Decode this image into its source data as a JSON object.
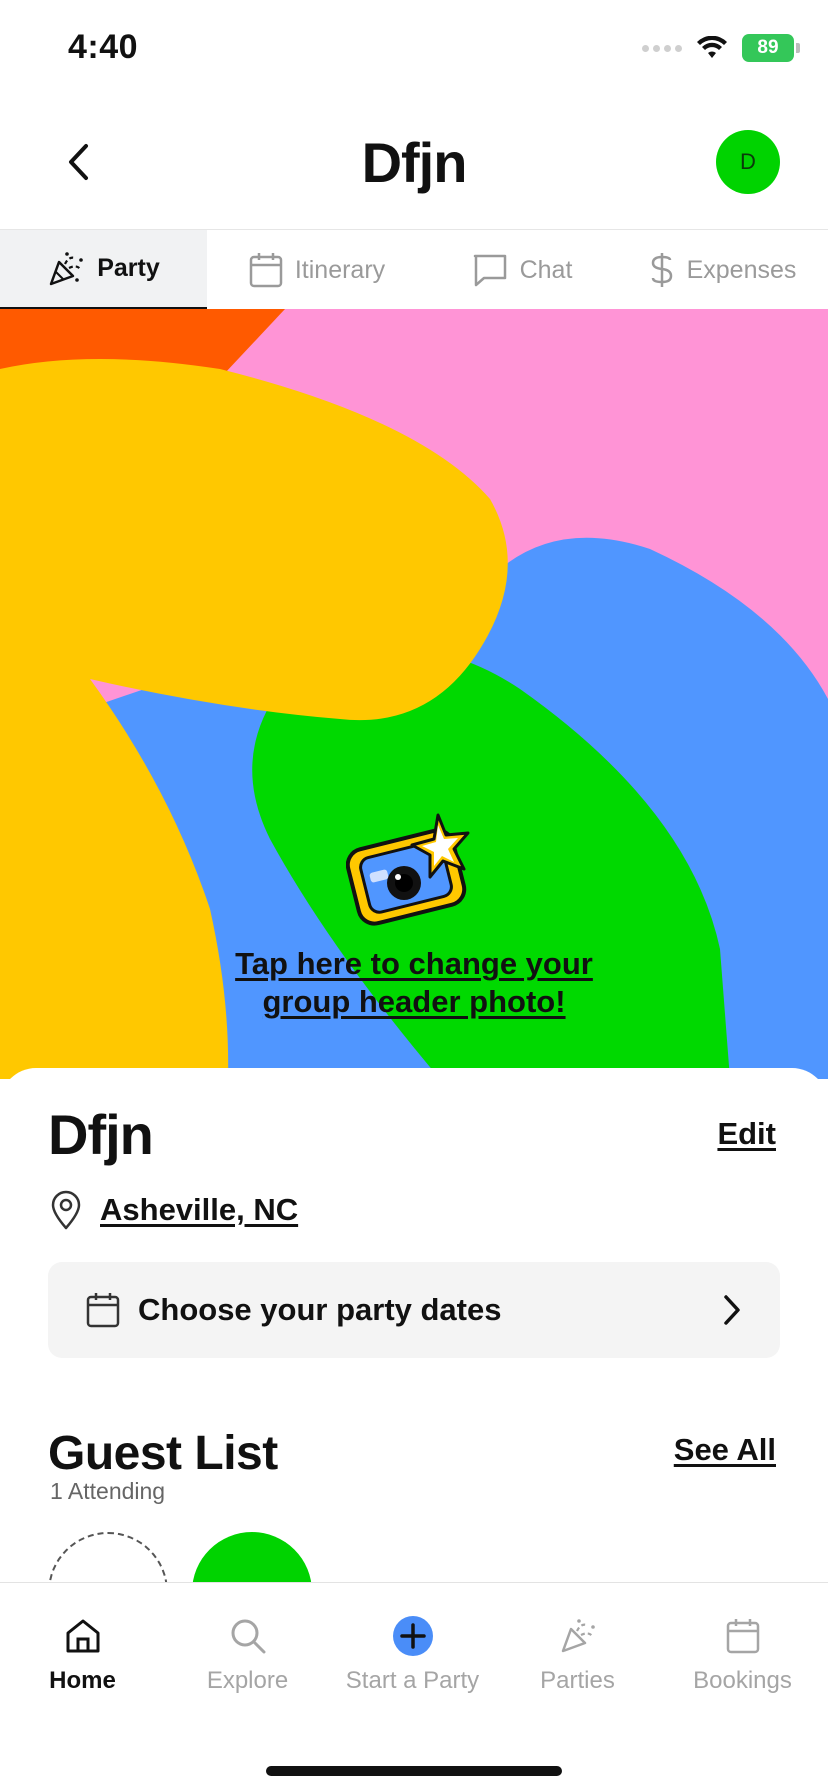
{
  "status_bar": {
    "time": "4:40",
    "battery": "89"
  },
  "header": {
    "title": "Dfjn",
    "avatar_initial": "D"
  },
  "tabs": [
    {
      "label": "Party",
      "icon": "party-popper-icon",
      "active": true
    },
    {
      "label": "Itinerary",
      "icon": "calendar-icon",
      "active": false
    },
    {
      "label": "Chat",
      "icon": "chat-bubble-icon",
      "active": false
    },
    {
      "label": "Expenses",
      "icon": "dollar-icon",
      "active": false
    }
  ],
  "hero": {
    "change_photo_line1": "Tap here to change your",
    "change_photo_line2": "group header photo!",
    "colors": {
      "orange": "#ff5a00",
      "pink": "#ff94d6",
      "yellow": "#ffc800",
      "blue": "#5096ff",
      "green": "#00d900"
    }
  },
  "party": {
    "name": "Dfjn",
    "edit_label": "Edit",
    "location": "Asheville, NC",
    "dates_label": "Choose your party dates"
  },
  "guest_list": {
    "title": "Guest List",
    "see_all_label": "See All",
    "attending": "1 Attending"
  },
  "bottom_nav": [
    {
      "label": "Home",
      "icon": "home-icon",
      "active": true
    },
    {
      "label": "Explore",
      "icon": "search-icon",
      "active": false
    },
    {
      "label": "Start a Party",
      "icon": "plus-circle-icon",
      "active": false
    },
    {
      "label": "Parties",
      "icon": "party-popper-icon",
      "active": false
    },
    {
      "label": "Bookings",
      "icon": "calendar-icon",
      "active": false
    }
  ],
  "colors": {
    "accent_green": "#00d300",
    "nav_plus_blue": "#4a8df8"
  }
}
